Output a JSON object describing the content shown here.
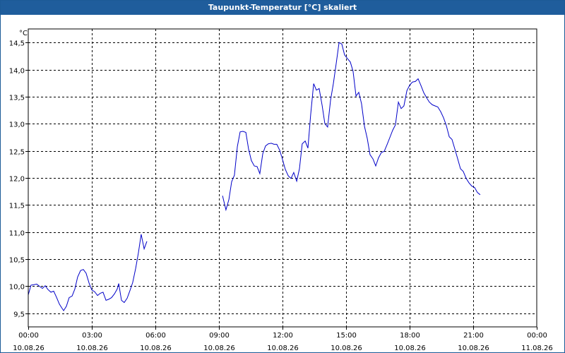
{
  "window": {
    "title": "Taupunkt-Temperatur [°C] skaliert"
  },
  "chart_data": {
    "type": "line",
    "title": "Taupunkt-Temperatur [°C] skaliert",
    "ylabel": "°C",
    "xlabel": "",
    "ylim": [
      9.25,
      14.75
    ],
    "xlim": [
      0,
      24
    ],
    "grid": true,
    "y_ticks": [
      "14,5",
      "14,0",
      "13,5",
      "13,0",
      "12,5",
      "12,0",
      "11,5",
      "11,0",
      "10,5",
      "10,0",
      "9,5"
    ],
    "x_ticks": [
      {
        "time": "00:00",
        "date": "10.08.26"
      },
      {
        "time": "03:00",
        "date": "10.08.26"
      },
      {
        "time": "06:00",
        "date": "10.08.26"
      },
      {
        "time": "09:00",
        "date": "10.08.26"
      },
      {
        "time": "12:00",
        "date": "10.08.26"
      },
      {
        "time": "15:00",
        "date": "10.08.26"
      },
      {
        "time": "18:00",
        "date": "10.08.26"
      },
      {
        "time": "21:00",
        "date": "10.08.26"
      },
      {
        "time": "00:00",
        "date": "11.08.26"
      }
    ],
    "series": [
      {
        "color": "#0000c8",
        "segments": [
          [
            [
              0.0,
              9.84
            ],
            [
              0.13,
              10.02
            ],
            [
              0.27,
              10.03
            ],
            [
              0.4,
              10.04
            ],
            [
              0.53,
              10.0
            ],
            [
              0.67,
              9.96
            ],
            [
              0.8,
              10.01
            ],
            [
              0.93,
              9.94
            ],
            [
              1.07,
              9.89
            ],
            [
              1.2,
              9.91
            ],
            [
              1.33,
              9.8
            ],
            [
              1.47,
              9.67
            ],
            [
              1.6,
              9.59
            ],
            [
              1.67,
              9.55
            ],
            [
              1.8,
              9.63
            ],
            [
              1.93,
              9.79
            ],
            [
              2.07,
              9.82
            ],
            [
              2.2,
              9.95
            ],
            [
              2.33,
              10.17
            ],
            [
              2.47,
              10.29
            ],
            [
              2.6,
              10.31
            ],
            [
              2.73,
              10.24
            ],
            [
              2.87,
              10.06
            ],
            [
              3.0,
              9.93
            ],
            [
              3.13,
              9.9
            ],
            [
              3.27,
              9.83
            ],
            [
              3.4,
              9.87
            ],
            [
              3.53,
              9.89
            ],
            [
              3.67,
              9.74
            ],
            [
              3.8,
              9.76
            ],
            [
              3.93,
              9.79
            ],
            [
              4.07,
              9.86
            ],
            [
              4.2,
              9.95
            ],
            [
              4.27,
              10.05
            ],
            [
              4.4,
              9.74
            ],
            [
              4.53,
              9.7
            ],
            [
              4.67,
              9.78
            ],
            [
              4.8,
              9.92
            ],
            [
              4.93,
              10.07
            ],
            [
              5.07,
              10.33
            ],
            [
              5.2,
              10.62
            ],
            [
              5.33,
              10.96
            ],
            [
              5.47,
              10.69
            ],
            [
              5.6,
              10.83
            ]
          ],
          [
            [
              9.17,
              11.67
            ],
            [
              9.33,
              11.41
            ],
            [
              9.47,
              11.6
            ],
            [
              9.6,
              11.93
            ],
            [
              9.73,
              12.05
            ],
            [
              9.87,
              12.58
            ],
            [
              10.0,
              12.85
            ],
            [
              10.13,
              12.86
            ],
            [
              10.27,
              12.84
            ],
            [
              10.4,
              12.53
            ],
            [
              10.53,
              12.32
            ],
            [
              10.67,
              12.22
            ],
            [
              10.8,
              12.21
            ],
            [
              10.93,
              12.08
            ],
            [
              11.07,
              12.45
            ],
            [
              11.2,
              12.59
            ],
            [
              11.33,
              12.63
            ],
            [
              11.47,
              12.64
            ],
            [
              11.6,
              12.62
            ],
            [
              11.73,
              12.62
            ],
            [
              11.87,
              12.51
            ],
            [
              12.0,
              12.34
            ],
            [
              12.13,
              12.16
            ],
            [
              12.27,
              12.04
            ],
            [
              12.4,
              11.99
            ],
            [
              12.53,
              12.1
            ],
            [
              12.67,
              11.94
            ],
            [
              12.8,
              12.17
            ],
            [
              12.93,
              12.63
            ],
            [
              13.07,
              12.68
            ],
            [
              13.2,
              12.55
            ],
            [
              13.33,
              13.17
            ],
            [
              13.47,
              13.74
            ],
            [
              13.6,
              13.62
            ],
            [
              13.73,
              13.65
            ],
            [
              13.87,
              13.34
            ],
            [
              14.0,
              13.0
            ],
            [
              14.13,
              12.94
            ],
            [
              14.27,
              13.44
            ],
            [
              14.4,
              13.74
            ],
            [
              14.53,
              14.1
            ],
            [
              14.67,
              14.5
            ],
            [
              14.8,
              14.47
            ],
            [
              14.93,
              14.27
            ],
            [
              15.07,
              14.2
            ],
            [
              15.2,
              14.14
            ],
            [
              15.33,
              13.97
            ],
            [
              15.47,
              13.51
            ],
            [
              15.6,
              13.58
            ],
            [
              15.73,
              13.37
            ],
            [
              15.87,
              12.95
            ],
            [
              16.0,
              12.73
            ],
            [
              16.13,
              12.43
            ],
            [
              16.27,
              12.35
            ],
            [
              16.4,
              12.22
            ],
            [
              16.53,
              12.37
            ],
            [
              16.67,
              12.47
            ],
            [
              16.8,
              12.49
            ],
            [
              16.93,
              12.61
            ],
            [
              17.07,
              12.75
            ],
            [
              17.2,
              12.88
            ],
            [
              17.33,
              12.98
            ],
            [
              17.47,
              13.4
            ],
            [
              17.6,
              13.28
            ],
            [
              17.73,
              13.33
            ],
            [
              17.87,
              13.61
            ],
            [
              18.0,
              13.71
            ],
            [
              18.13,
              13.77
            ],
            [
              18.27,
              13.78
            ],
            [
              18.4,
              13.83
            ],
            [
              18.53,
              13.71
            ],
            [
              18.67,
              13.57
            ],
            [
              18.8,
              13.48
            ],
            [
              18.93,
              13.4
            ],
            [
              19.07,
              13.35
            ],
            [
              19.2,
              13.33
            ],
            [
              19.33,
              13.31
            ],
            [
              19.47,
              13.22
            ],
            [
              19.6,
              13.11
            ],
            [
              19.73,
              12.97
            ],
            [
              19.87,
              12.76
            ],
            [
              20.0,
              12.71
            ],
            [
              20.13,
              12.54
            ],
            [
              20.27,
              12.35
            ],
            [
              20.4,
              12.17
            ],
            [
              20.53,
              12.12
            ],
            [
              20.67,
              11.99
            ],
            [
              20.8,
              11.91
            ],
            [
              20.93,
              11.85
            ],
            [
              21.07,
              11.82
            ],
            [
              21.2,
              11.73
            ],
            [
              21.33,
              11.69
            ]
          ]
        ]
      }
    ]
  }
}
